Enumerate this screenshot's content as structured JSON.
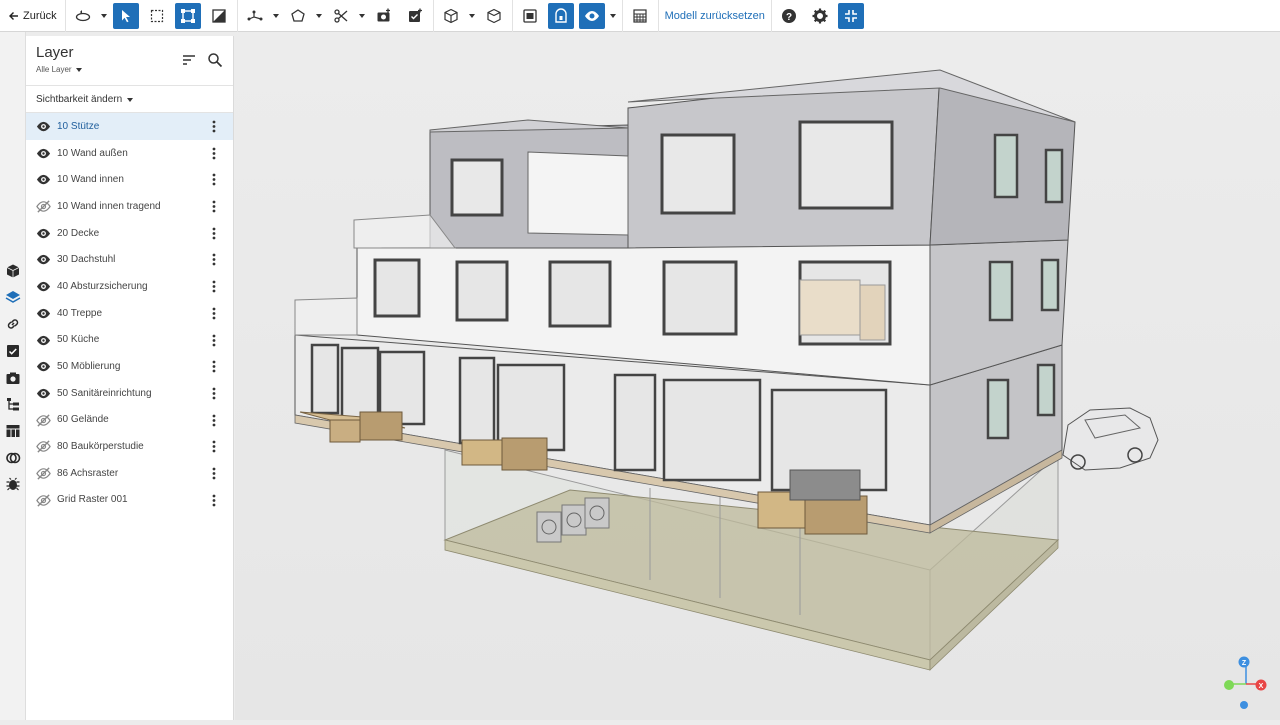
{
  "toolbar": {
    "back_label": "Zurück",
    "reset_model_label": "Modell zurücksetzen",
    "tools": [
      "orbit-icon",
      "select-arrow-icon",
      "box-select-icon",
      "bounding-box-icon",
      "section-icon",
      "measure-icon",
      "polygon-icon",
      "cut-icon",
      "camera-add-icon",
      "task-add-icon",
      "cube-icon",
      "cube-outline-icon",
      "view-camera-icon",
      "lock-frame-icon",
      "eye-icon",
      "grid-icon",
      "help-icon",
      "gear-icon",
      "collapse-icon"
    ]
  },
  "rail": {
    "items": [
      "objects-icon",
      "layers-icon",
      "links-icon",
      "tasks-icon",
      "snapshots-icon",
      "tree-icon",
      "table-icon",
      "clash-icon",
      "bug-icon"
    ]
  },
  "panel": {
    "title": "Layer",
    "filter_label": "Alle Layer",
    "visibility_label": "Sichtbarkeit ändern",
    "layers": [
      {
        "name": "10 Stütze",
        "visible": true,
        "selected": true
      },
      {
        "name": "10 Wand außen",
        "visible": true
      },
      {
        "name": "10 Wand innen",
        "visible": true
      },
      {
        "name": "10 Wand innen tragend",
        "visible": false
      },
      {
        "name": "20 Decke",
        "visible": true
      },
      {
        "name": "30 Dachstuhl",
        "visible": true
      },
      {
        "name": "40 Absturzsicherung",
        "visible": true
      },
      {
        "name": "40 Treppe",
        "visible": true
      },
      {
        "name": "50 Küche",
        "visible": true
      },
      {
        "name": "50 Möblierung",
        "visible": true
      },
      {
        "name": "50 Sanitäreinrichtung",
        "visible": true
      },
      {
        "name": "60 Gelände",
        "visible": false
      },
      {
        "name": "80 Baukörperstudie",
        "visible": false
      },
      {
        "name": "86 Achsraster",
        "visible": false
      },
      {
        "name": "Grid Raster 001",
        "visible": false
      }
    ]
  },
  "viewport": {
    "axis_labels": {
      "z": "Z",
      "x": "X"
    },
    "colors": {
      "accent": "#1f6fb8",
      "axis_z": "#3d8fe0",
      "axis_x": "#e84545",
      "axis_y": "#7ed957"
    }
  }
}
